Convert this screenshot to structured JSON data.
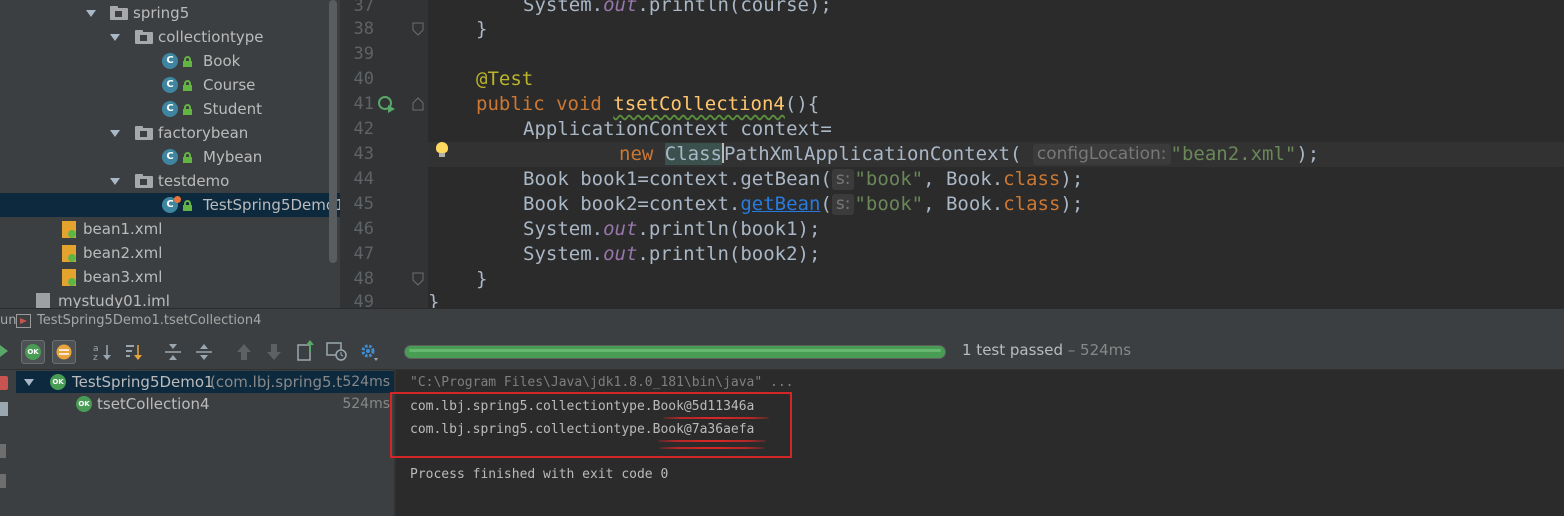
{
  "project_tree": {
    "items": [
      {
        "label": "spring5",
        "type": "package",
        "level": 0
      },
      {
        "label": "collectiontype",
        "type": "package",
        "level": 1
      },
      {
        "label": "Book",
        "type": "class",
        "level": 2
      },
      {
        "label": "Course",
        "type": "class",
        "level": 2
      },
      {
        "label": "Student",
        "type": "class",
        "level": 2
      },
      {
        "label": "factorybean",
        "type": "package",
        "level": 1
      },
      {
        "label": "Mybean",
        "type": "class",
        "level": 2
      },
      {
        "label": "testdemo",
        "type": "package",
        "level": 1
      },
      {
        "label": "TestSpring5Demo1",
        "type": "class",
        "level": 2,
        "selected": true
      },
      {
        "label": "bean1.xml",
        "type": "xml"
      },
      {
        "label": "bean2.xml",
        "type": "xml"
      },
      {
        "label": "bean3.xml",
        "type": "xml"
      },
      {
        "label": "mystudy01.iml",
        "type": "iml"
      }
    ]
  },
  "editor": {
    "line_numbers": [
      "37",
      "38",
      "39",
      "40",
      "41",
      "42",
      "43",
      "44",
      "45",
      "46",
      "47",
      "48",
      "49"
    ],
    "lines": {
      "l37_a": "System.",
      "l37_b": "out",
      "l37_c": ".println(course);",
      "l38": "}",
      "l40": "@Test",
      "l41_kw": "public void ",
      "l41_fn": "tsetCollection4",
      "l41_rest": "(){",
      "l42": "ApplicationContext context=",
      "l43_new": "new ",
      "l43_class1": "Class",
      "l43_class2": "PathXmlApplicationContext(",
      "l43_hint": "configLocation:",
      "l43_str": "\"bean2.xml\"",
      "l43_end": ");",
      "l44_a": "Book book1=context.getBean(",
      "l44_hint": "s:",
      "l44_str": "\"book\"",
      "l44_b": ", Book.",
      "l44_kw": "class",
      "l44_end": ");",
      "l45_a": "Book book2=context.",
      "l45_link": "getBean",
      "l45_b": "(",
      "l45_hint": "s:",
      "l45_str": "\"book\"",
      "l45_c": ", Book.",
      "l45_kw": "class",
      "l45_end": ");",
      "l46_a": "System.",
      "l46_b": "out",
      "l46_c": ".println(book1);",
      "l47_a": "System.",
      "l47_b": "out",
      "l47_c": ".println(book2);",
      "l48": "}",
      "l49": "}"
    }
  },
  "run_panel": {
    "tab_prefix": "un",
    "title": "TestSpring5Demo1.tsetCollection4",
    "status": "1 test passed",
    "duration": " – 524ms",
    "progress_fraction": 1.0,
    "ok_badge": "OK",
    "tests": [
      {
        "name": "TestSpring5Demo1",
        "package": " (com.lbj.spring5.t",
        "time": "524ms"
      },
      {
        "name": "tsetCollection4",
        "time": "524ms"
      }
    ]
  },
  "console": {
    "command": "\"C:\\Program Files\\Java\\jdk1.8.0_181\\bin\\java\" ...",
    "output": [
      "com.lbj.spring5.collectiontype.Book@5d11346a",
      "com.lbj.spring5.collectiontype.Book@7a36aefa"
    ],
    "exit": "Process finished with exit code 0"
  },
  "colors": {
    "pass_green": "#499c54",
    "annotation_red": "#d32727",
    "keyword": "#cc7832",
    "string": "#6a8759"
  }
}
